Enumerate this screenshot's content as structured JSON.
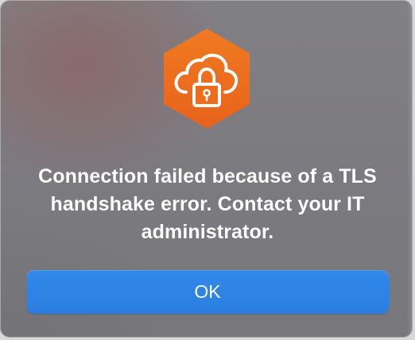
{
  "dialog": {
    "icon": "orange-hexagon-cloud-lock-icon",
    "message": "Connection failed because of a TLS handshake error. Contact your IT administrator.",
    "ok_label": "OK"
  },
  "colors": {
    "icon_orange": "#ee6c1c",
    "button_blue": "#2f84e6",
    "text": "#ffffff",
    "background_gray": "#7d7c80"
  }
}
